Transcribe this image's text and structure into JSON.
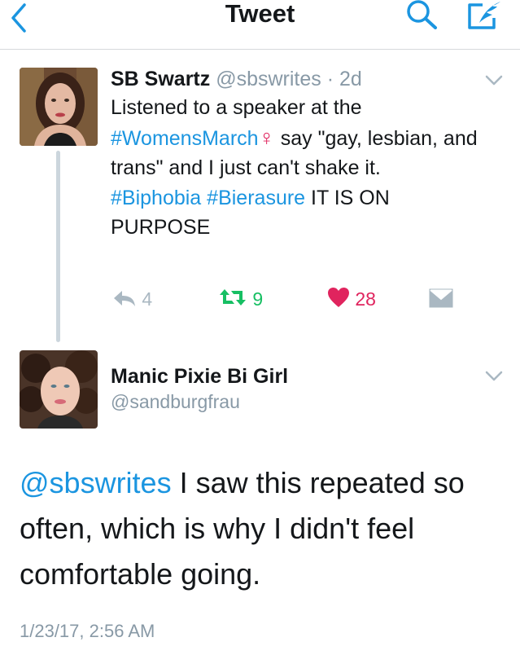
{
  "header": {
    "title": "Tweet",
    "back_icon": "chevron-left-icon",
    "search_icon": "search-icon",
    "compose_icon": "compose-icon",
    "accent": "#1b95e0"
  },
  "tweet1": {
    "name": "SB Swartz",
    "handle": "@sbswrites",
    "separator": "·",
    "time": "2d",
    "body": {
      "t1": "Listened to a speaker at the",
      "hashtag1": "#WomensMarch",
      "symbol": "♀",
      "t2": " say \"gay, lesbian, and trans\" and I just can't shake it.",
      "hashtag2": "#Biphobia",
      "hashtag3": "#Bierasure",
      "t3": " IT IS ON PURPOSE"
    },
    "reply_count": "4",
    "retweet_count": "9",
    "like_count": "28"
  },
  "tweet2": {
    "name": "Manic Pixie Bi Girl",
    "handle": "@sandburgfrau",
    "mention": "@sbswrites",
    "body": " I saw this repeated so often, which is why I didn't feel comfortable going.",
    "timestamp": "1/23/17, 2:56 AM"
  },
  "colors": {
    "like": "#e0245e",
    "retweet": "#17bf63",
    "link": "#1b95e0",
    "muted": "#8899a6"
  }
}
